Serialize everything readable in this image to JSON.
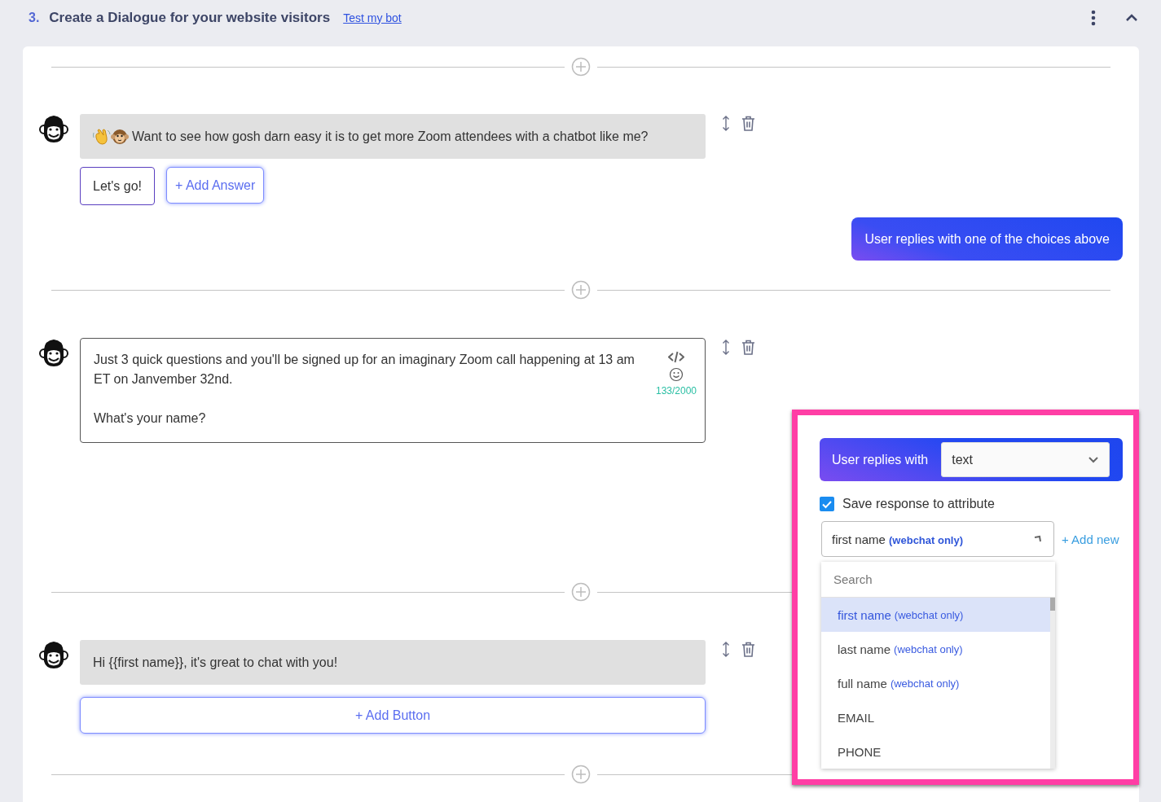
{
  "section": {
    "number": "3.",
    "title": "Create a Dialogue for your website visitors",
    "link": "Test my bot"
  },
  "blocks": [
    {
      "kind": "emoji-message",
      "text": "Want to see how gosh darn easy it is to get more Zoom attendees with a chatbot like me?",
      "answers": [
        {
          "label": "Let's go!"
        }
      ],
      "add_answer": "+ Add Answer",
      "user_reply": "User replies with one of the choices above"
    },
    {
      "kind": "editor",
      "paragraphs": [
        "Just 3 quick questions and you'll be signed up for an imaginary Zoom call happening at 13 am ET on Janvember 32nd.",
        "What's your name?"
      ],
      "counter": "133/2000"
    },
    {
      "kind": "message",
      "text": "Hi {{first name}}, it's great to chat with you!",
      "add_button": "+ Add Button"
    }
  ],
  "reply_panel": {
    "label": "User replies with",
    "reply_type": "text",
    "save_checked": true,
    "save_label": "Save response to attribute",
    "attribute": {
      "name": "first name",
      "note": "(webchat only)"
    },
    "add_new": "+ Add new",
    "search_placeholder": "Search",
    "options": [
      {
        "name": "first name",
        "note": "(webchat only)",
        "selected": true
      },
      {
        "name": "last name",
        "note": "(webchat only)",
        "selected": false
      },
      {
        "name": "full name",
        "note": "(webchat only)",
        "selected": false
      },
      {
        "name": "EMAIL",
        "selected": false
      },
      {
        "name": "PHONE",
        "selected": false
      }
    ]
  }
}
